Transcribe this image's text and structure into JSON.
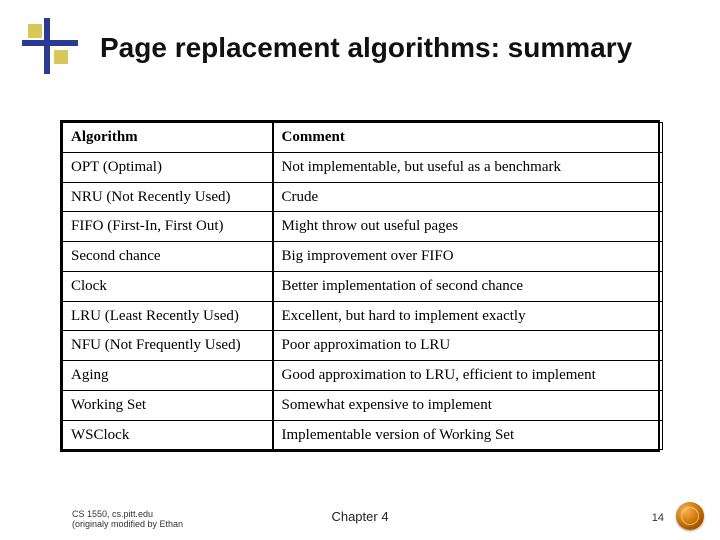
{
  "title": "Page replacement algorithms: summary",
  "table": {
    "headers": {
      "algorithm": "Algorithm",
      "comment": "Comment"
    },
    "rows": [
      {
        "algorithm": "OPT (Optimal)",
        "comment": "Not implementable, but useful as a benchmark"
      },
      {
        "algorithm": "NRU (Not Recently Used)",
        "comment": "Crude"
      },
      {
        "algorithm": "FIFO (First-In, First Out)",
        "comment": "Might throw out useful pages"
      },
      {
        "algorithm": "Second chance",
        "comment": "Big improvement over FIFO"
      },
      {
        "algorithm": "Clock",
        "comment": "Better implementation of second chance"
      },
      {
        "algorithm": "LRU (Least Recently Used)",
        "comment": "Excellent, but hard to implement exactly"
      },
      {
        "algorithm": "NFU (Not Frequently Used)",
        "comment": "Poor approximation to LRU"
      },
      {
        "algorithm": "Aging",
        "comment": "Good approximation to LRU, efficient to implement"
      },
      {
        "algorithm": "Working Set",
        "comment": "Somewhat expensive to implement"
      },
      {
        "algorithm": "WSClock",
        "comment": "Implementable version of Working Set"
      }
    ]
  },
  "footer": {
    "credit_line1": "CS 1550, cs.pitt.edu",
    "credit_line2": "(originaly modified by Ethan",
    "chapter": "Chapter 4",
    "page": "14"
  }
}
